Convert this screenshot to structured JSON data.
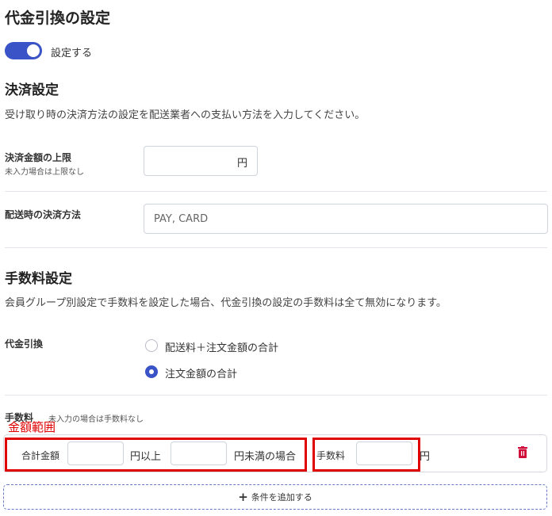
{
  "page": {
    "title": "代金引換の設定",
    "toggle": {
      "label": "設定する",
      "on": true
    }
  },
  "payment_settings": {
    "heading": "決済設定",
    "description": "受け取り時の決済方法の設定を配送業者への支払い方法を入力してください。",
    "limit_label": "決済金額の上限",
    "limit_sublabel": "未入力場合は上限なし",
    "limit_value": "",
    "limit_unit": "円",
    "method_label": "配送時の決済方法",
    "method_placeholder": "PAY, CARD"
  },
  "fee_settings": {
    "heading": "手数料設定",
    "description": "会員グループ別設定で手数料を設定した場合、代金引換の設定の手数料は全て無効になります。",
    "cod_label": "代金引換",
    "options": [
      {
        "label": "配送料＋注文金額の合計",
        "selected": false
      },
      {
        "label": "注文金額の合計",
        "selected": true
      }
    ],
    "fee_label": "手数料",
    "fee_note": "未入力の場合は手数料なし",
    "annotation": "金額範囲",
    "row": {
      "total_label": "合計金額",
      "from_value": "",
      "from_suffix": "円以上",
      "to_value": "",
      "to_suffix": "円未満の場合",
      "fee_label": "手数料",
      "fee_value": "",
      "fee_unit": "円"
    },
    "add_condition_label": "条件を追加する"
  },
  "colors": {
    "accent": "#3a53c6",
    "annotation_red": "#e00000",
    "delete_icon": "#d0103a"
  }
}
